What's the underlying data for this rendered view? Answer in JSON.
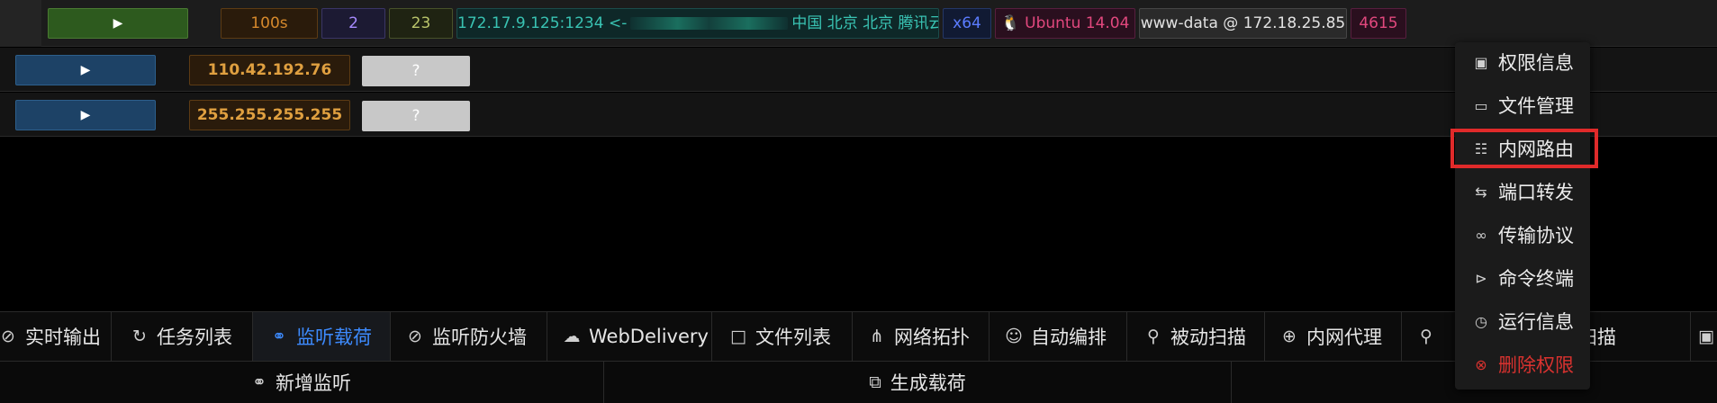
{
  "session": {
    "run_icon": "play-icon",
    "duration": "100s",
    "count_a": "2",
    "count_b": "23",
    "addr_prefix": "172.17.9.125:1234 <-",
    "location": "中国 北京 北京 腾讯云",
    "arch": "x64",
    "os": "🐧 Ubuntu 14.04",
    "user": "www-data @ 172.18.25.85",
    "pid": "4615"
  },
  "hosts": [
    {
      "ip": "110.42.192.76",
      "status": "?"
    },
    {
      "ip": "255.255.255.255",
      "status": "?"
    }
  ],
  "tabs": [
    {
      "label": "实时输出",
      "icon": "console-icon"
    },
    {
      "label": "任务列表",
      "icon": "history-icon"
    },
    {
      "label": "监听载荷",
      "icon": "headphones-icon",
      "active": true
    },
    {
      "label": "监听防火墙",
      "icon": "link-broken-icon"
    },
    {
      "label": "WebDelivery",
      "icon": "cloud-upload-icon"
    },
    {
      "label": "文件列表",
      "icon": "folder-open-icon"
    },
    {
      "label": "网络拓扑",
      "icon": "topology-icon"
    },
    {
      "label": "自动编排",
      "icon": "robot-icon"
    },
    {
      "label": "被动扫描",
      "icon": "search-icon"
    },
    {
      "label": "内网代理",
      "icon": "proxy-icon"
    },
    {
      "label": "全网扫描",
      "icon": "search-icon"
    }
  ],
  "bottom_buttons": [
    {
      "label": "新增监听",
      "icon": "headphones-icon"
    },
    {
      "label": "生成载荷",
      "icon": "copy-icon"
    }
  ],
  "context_menu": {
    "items": [
      {
        "label": "权限信息",
        "icon": "id-card-icon"
      },
      {
        "label": "文件管理",
        "icon": "monitor-icon"
      },
      {
        "label": "内网路由",
        "icon": "route-icon",
        "highlighted": true
      },
      {
        "label": "端口转发",
        "icon": "swap-icon"
      },
      {
        "label": "传输协议",
        "icon": "link-icon"
      },
      {
        "label": "命令终端",
        "icon": "terminal-icon"
      },
      {
        "label": "运行信息",
        "icon": "dashboard-icon"
      },
      {
        "label": "删除权限",
        "icon": "close-circle-icon",
        "danger": true
      }
    ]
  },
  "colors": {
    "active_tab": "#3d8bff",
    "highlight_border": "#e02a2a",
    "danger": "#d9322f"
  }
}
